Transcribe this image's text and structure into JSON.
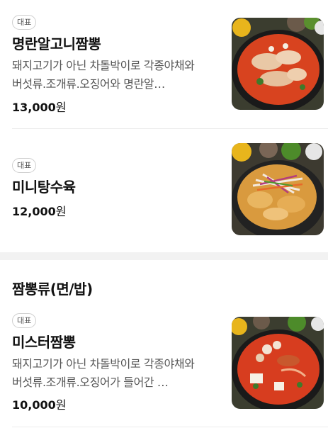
{
  "items": [
    {
      "badge": "대표",
      "name": "명란알고니짬뽕",
      "description": "돼지고기가 아닌 차돌박이로 각종야채와 버섯류.조개류.오징어와 명란알…",
      "price": "13,000",
      "currency": "원",
      "image": "spicy-seafood-noodle-soup-with-pollock-roe"
    },
    {
      "badge": "대표",
      "name": "미니탕수육",
      "description": "",
      "price": "12,000",
      "currency": "원",
      "image": "sweet-and-sour-pork-with-vegetables"
    },
    {
      "badge": "대표",
      "name": "미스터짬뽕",
      "description": "돼지고기가 아닌 차돌박이로 각종야채와 버섯류.조개류.오징어가 들어간 …",
      "price": "10,000",
      "currency": "원",
      "image": "spicy-seafood-noodle-soup"
    }
  ],
  "section": {
    "title": "짬뽕류(면/밥)"
  }
}
